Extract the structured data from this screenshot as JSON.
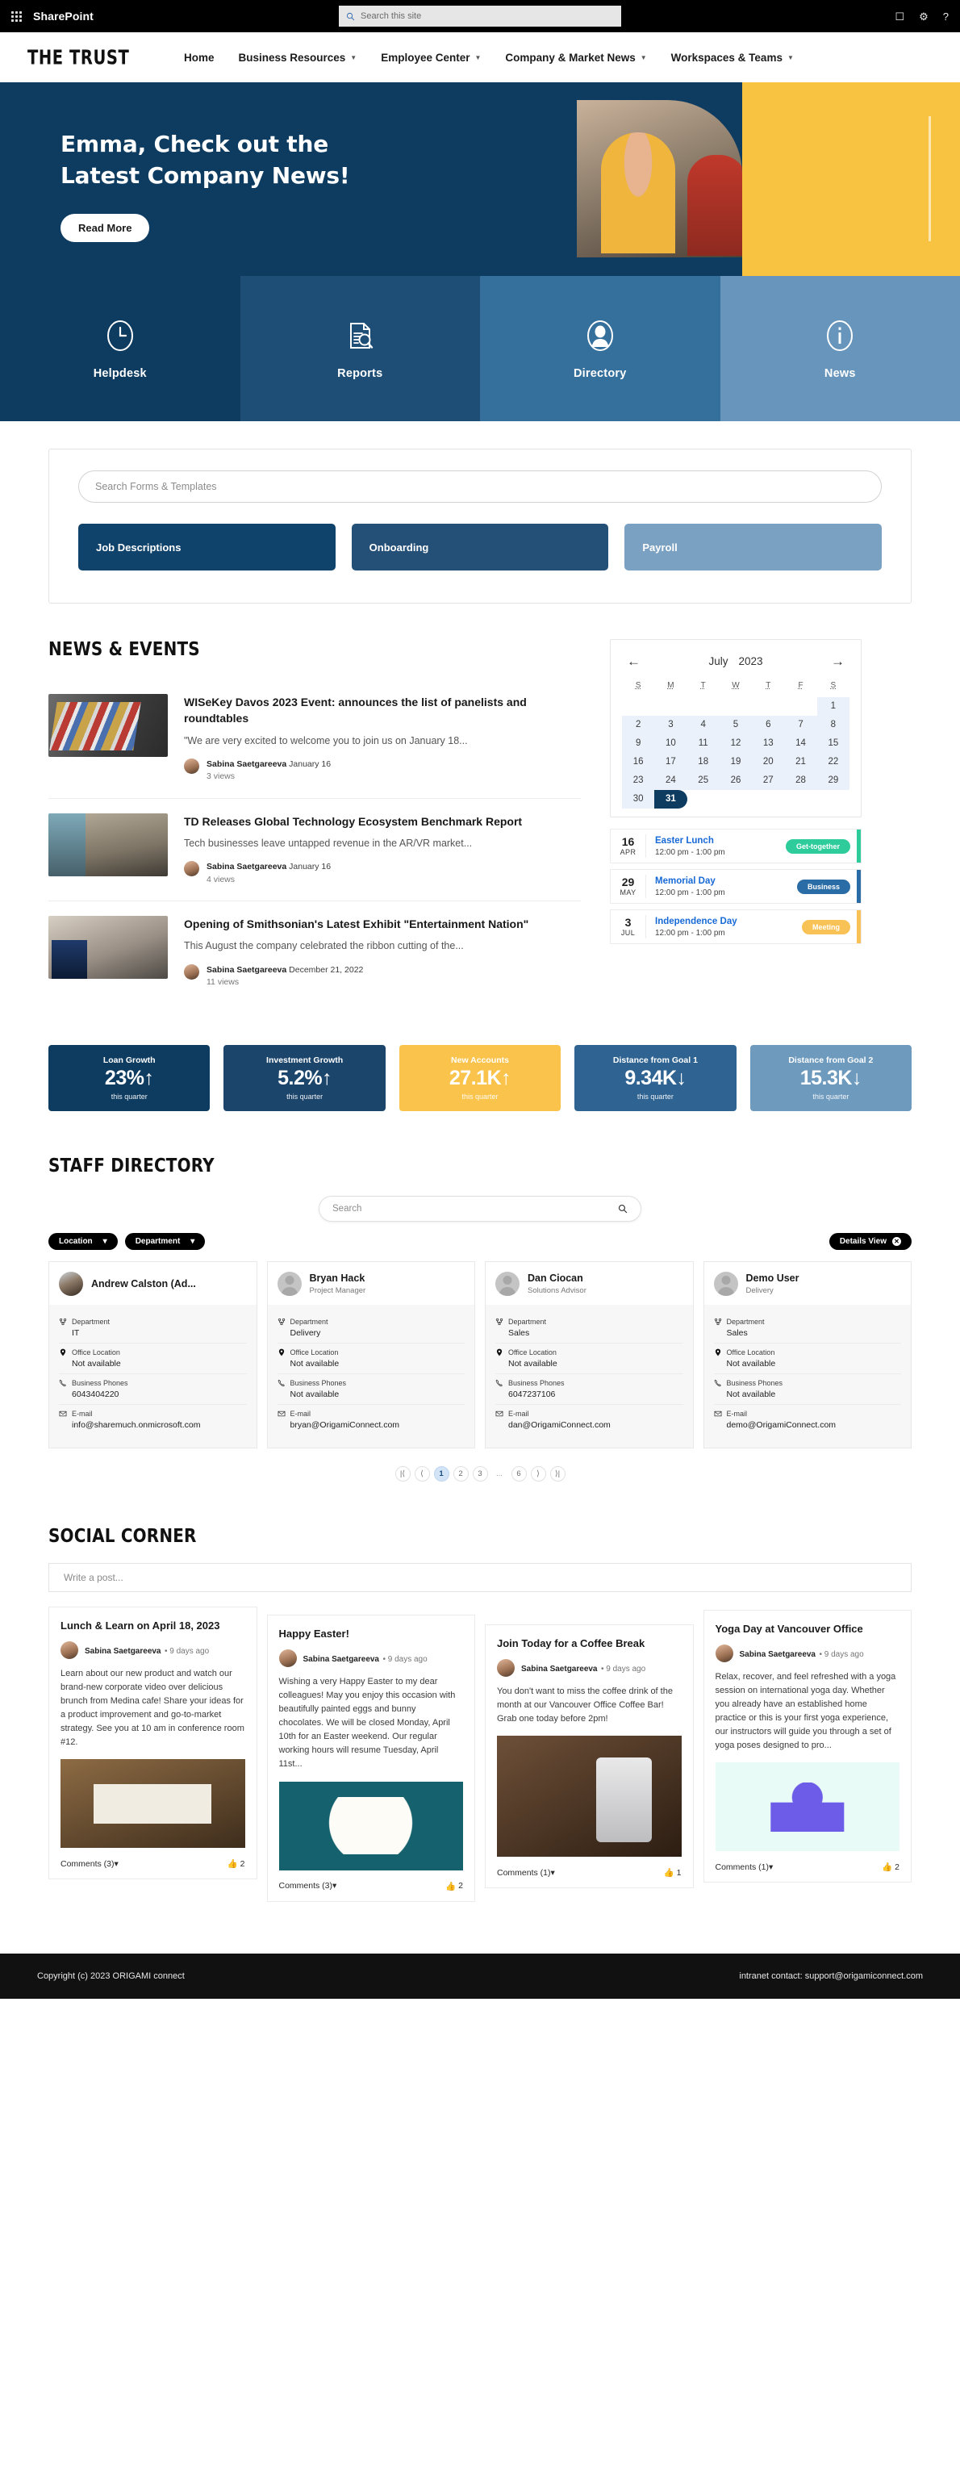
{
  "suitebar": {
    "app_name": "SharePoint",
    "search_placeholder": "Search this site",
    "icons": [
      "waffle-icon",
      "search-icon",
      "rooms-icon",
      "settings-icon",
      "help-icon"
    ]
  },
  "brand": {
    "logo": "THE TRUST",
    "nav": [
      {
        "label": "Home",
        "has_caret": false
      },
      {
        "label": "Business Resources",
        "has_caret": true
      },
      {
        "label": "Employee Center",
        "has_caret": true
      },
      {
        "label": "Company & Market News",
        "has_caret": true
      },
      {
        "label": "Workspaces & Teams",
        "has_caret": true
      }
    ]
  },
  "hero": {
    "line1": "Emma, Check out the",
    "line2": "Latest Company News!",
    "button": "Read More",
    "bg_color": "#0e3c61",
    "accent_color": "#f8c340"
  },
  "tiles": [
    {
      "label": "Helpdesk",
      "icon": "clock-icon",
      "color": "#0e3c61"
    },
    {
      "label": "Reports",
      "icon": "document-search-icon",
      "color": "#1e4e76"
    },
    {
      "label": "Directory",
      "icon": "person-icon",
      "color": "#356f9c"
    },
    {
      "label": "News",
      "icon": "info-icon",
      "color": "#6795bb"
    }
  ],
  "forms": {
    "search_placeholder": "Search Forms & Templates",
    "categories": [
      {
        "label": "Job Descriptions",
        "color": "#10436b"
      },
      {
        "label": "Onboarding",
        "color": "#244f76"
      },
      {
        "label": "Payroll",
        "color": "#7ba1c2"
      }
    ]
  },
  "news": {
    "heading": "NEWS & EVENTS",
    "items": [
      {
        "title": "WISeKey Davos 2023 Event: announces the list of panelists and roundtables",
        "desc": "\"We are very excited to welcome you to join us on January 18...",
        "author": "Sabina Saetgareeva",
        "date": "January 16",
        "views": "3 views"
      },
      {
        "title": "TD Releases Global Technology Ecosystem Benchmark Report",
        "desc": "Tech businesses leave untapped revenue in the AR/VR market...",
        "author": "Sabina Saetgareeva",
        "date": "January 16",
        "views": "4 views"
      },
      {
        "title": "Opening of Smithsonian's Latest Exhibit \"Entertainment Nation\"",
        "desc": "This August the company celebrated the ribbon cutting of the...",
        "author": "Sabina Saetgareeva",
        "date": "December 21, 2022",
        "views": "11 views"
      }
    ]
  },
  "calendar": {
    "month": "July",
    "year": "2023",
    "prev_icon": "arrow-left-icon",
    "next_icon": "arrow-right-icon",
    "dow": [
      "S",
      "M",
      "T",
      "W",
      "T",
      "F",
      "S"
    ],
    "lead_blanks": 6,
    "days": [
      1,
      2,
      3,
      4,
      5,
      6,
      7,
      8,
      9,
      10,
      11,
      12,
      13,
      14,
      15,
      16,
      17,
      18,
      19,
      20,
      21,
      22,
      23,
      24,
      25,
      26,
      27,
      28,
      29,
      30,
      31
    ],
    "selected": 31,
    "events": [
      {
        "day": "16",
        "month": "APR",
        "title": "Easter Lunch",
        "time": "12:00 pm - 1:00 pm",
        "badge": "Get-together",
        "color": "#2ecc9b"
      },
      {
        "day": "29",
        "month": "MAY",
        "title": "Memorial Day",
        "time": "12:00 pm - 1:00 pm",
        "badge": "Business",
        "color": "#2a6ca5"
      },
      {
        "day": "3",
        "month": "JUL",
        "title": "Independence Day",
        "time": "12:00 pm - 1:00 pm",
        "badge": "Meeting",
        "color": "#f9c257"
      }
    ]
  },
  "kpis": [
    {
      "label": "Loan Growth",
      "value": "23%",
      "arrow": "↑",
      "sub": "this quarter",
      "bg": "#0e3c61",
      "fg": "#ffffff"
    },
    {
      "label": "Investment Growth",
      "value": "5.2%",
      "arrow": "↑",
      "sub": "this quarter",
      "bg": "#1c456c",
      "fg": "#ffffff"
    },
    {
      "label": "New Accounts",
      "value": "27.1K",
      "arrow": "↑",
      "sub": "this quarter",
      "bg": "#fac44c",
      "fg": "#ffffff"
    },
    {
      "label": "Distance from Goal 1",
      "value": "9.34K",
      "arrow": "↓",
      "sub": "this quarter",
      "bg": "#2f6391",
      "fg": "#ffffff"
    },
    {
      "label": "Distance from Goal 2",
      "value": "15.3K",
      "arrow": "↓",
      "sub": "this quarter",
      "bg": "#6e9abe",
      "fg": "#ffffff"
    }
  ],
  "staff": {
    "heading": "STAFF DIRECTORY",
    "search_placeholder": "Search",
    "filters": [
      {
        "label": "Location",
        "icon": "chevron-down-icon"
      },
      {
        "label": "Department",
        "icon": "chevron-down-icon"
      }
    ],
    "view_toggle": "Details View",
    "field_labels": {
      "department": "Department",
      "office": "Office Location",
      "phone": "Business Phones",
      "email": "E-mail"
    },
    "cards": [
      {
        "name": "Andrew Calston (Ad...",
        "role": "",
        "department": "IT",
        "office": "Not available",
        "phone": "6043404220",
        "email": "info@sharemuch.onmicrosoft.com",
        "has_photo": true
      },
      {
        "name": "Bryan Hack",
        "role": "Project Manager",
        "department": "Delivery",
        "office": "Not available",
        "phone": "Not available",
        "email": "bryan@OrigamiConnect.com",
        "has_photo": false
      },
      {
        "name": "Dan Ciocan",
        "role": "Solutions Advisor",
        "department": "Sales",
        "office": "Not available",
        "phone": "6047237106",
        "email": "dan@OrigamiConnect.com",
        "has_photo": false
      },
      {
        "name": "Demo User",
        "role": "Delivery",
        "department": "Sales",
        "office": "Not available",
        "phone": "Not available",
        "email": "demo@OrigamiConnect.com",
        "has_photo": false
      }
    ],
    "pagination": {
      "first": "|⟨",
      "prev": "⟨",
      "pages": [
        "1",
        "2",
        "3"
      ],
      "dots": "...",
      "last_page": "6",
      "next": "⟩",
      "last": "⟩|",
      "active": "1"
    }
  },
  "social": {
    "heading": "SOCIAL CORNER",
    "post_placeholder": "Write a post...",
    "posts": [
      {
        "title": "Lunch & Learn on April 18, 2023",
        "author": "Sabina Saetgareeva",
        "ago": "9 days ago",
        "text": "Learn about our new product and watch our brand-new corporate video over delicious brunch from Medina cafe! Share your ideas for a product improvement and go-to-market strategy. See you at 10 am in conference room #12.",
        "image": "lunch-learn-brunch-image",
        "comments": "Comments (3)",
        "likes": "2"
      },
      {
        "title": "Happy Easter!",
        "author": "Sabina Saetgareeva",
        "ago": "9 days ago",
        "text": "Wishing a very Happy Easter to my dear colleagues! May you enjoy this occasion with beautifully painted eggs and bunny chocolates. We will be closed Monday, April 10th for an Easter weekend. Our regular working hours will resume Tuesday, April 11st...",
        "image": "happy-easter-image",
        "comments": "Comments (3)",
        "likes": "2"
      },
      {
        "title": "Join Today for a Coffee Break",
        "author": "Sabina Saetgareeva",
        "ago": "9 days ago",
        "text": "You don't want to miss the coffee drink of the month at our Vancouver Office Coffee Bar! Grab one today before 2pm!",
        "image": "coffee-break-image",
        "comments": "Comments (1)",
        "likes": "1"
      },
      {
        "title": "Yoga Day at Vancouver Office",
        "author": "Sabina Saetgareeva",
        "ago": "9 days ago",
        "text": "Relax, recover, and feel refreshed with a yoga session on international yoga day. Whether you already have an established home practice or this is your first yoga experience, our instructors will guide you through a set of yoga poses designed to pro...",
        "image": "yoga-day-image",
        "comments": "Comments (1)",
        "likes": "2"
      }
    ]
  },
  "footer": {
    "copyright": "Copyright (c) 2023 ORIGAMI connect",
    "contact": "intranet contact: support@origamiconnect.com"
  }
}
